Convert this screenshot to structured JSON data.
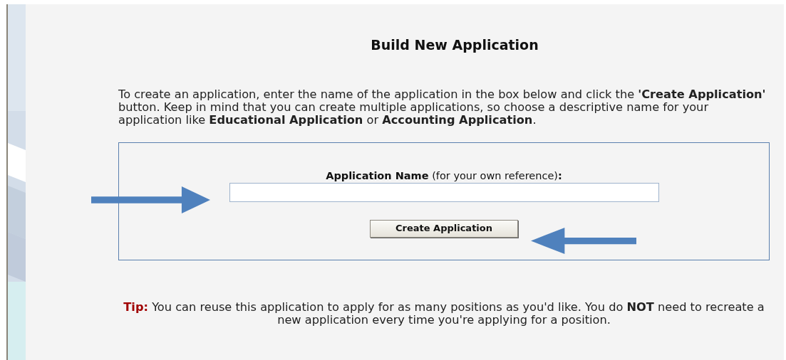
{
  "title": "Build New Application",
  "intro": "To create an application, enter the name of the application in the box below and click the **'Create Application'** button. Keep in mind that you can create multiple applications, so choose a descriptive name for your application like **Educational Application** or **Accounting Application**.",
  "form": {
    "label": "**Application Name** (for your own reference)**:**",
    "button": "Create Application"
  },
  "tip": {
    "label": "Tip:",
    "text": "You can reuse this application to apply for as many positions as you'd like. You do **NOT** need to recreate a new application every time you're applying for a position."
  }
}
